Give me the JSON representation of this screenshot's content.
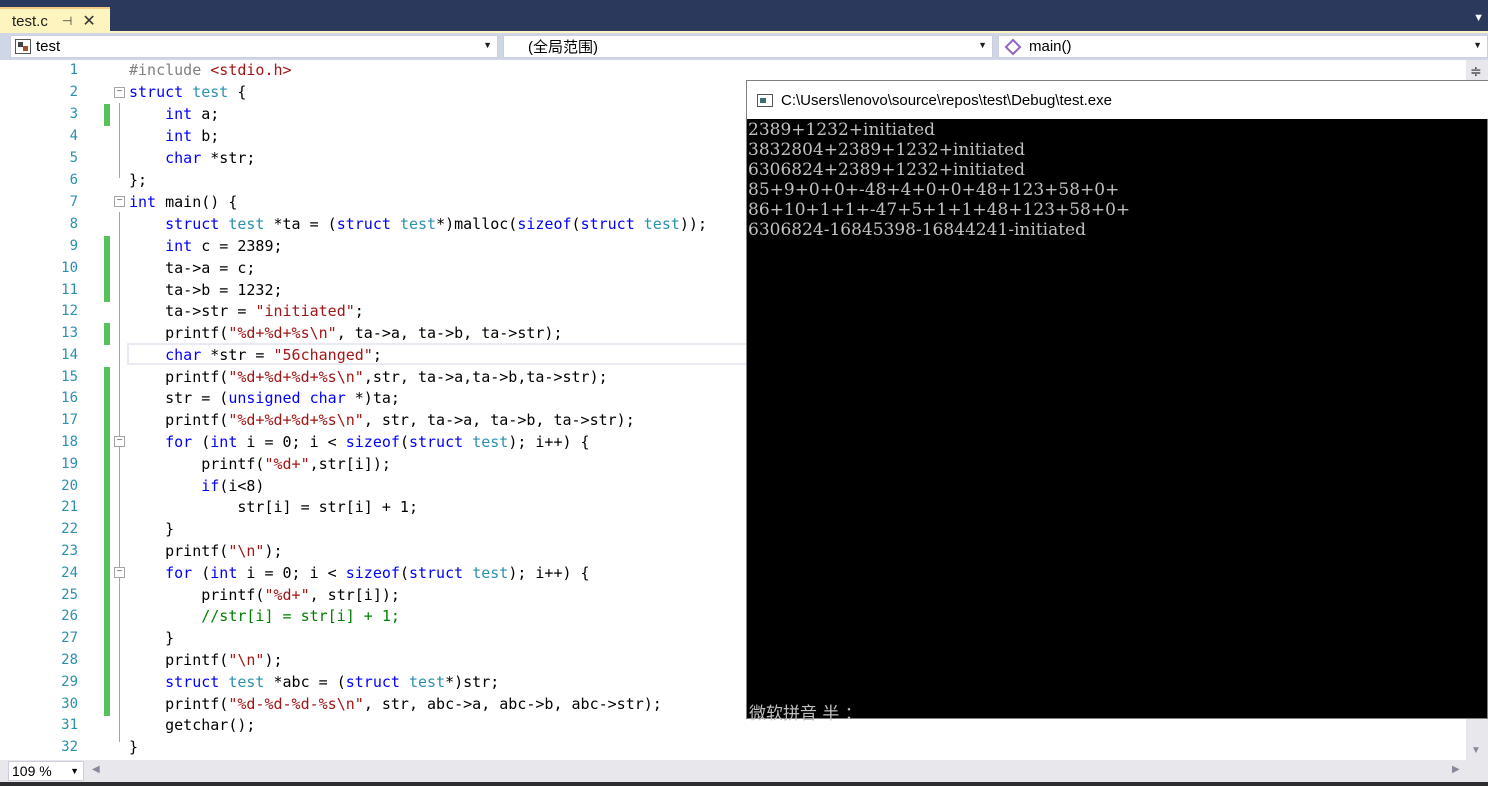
{
  "tab": {
    "title": "test.c",
    "pin": "⊣",
    "close": "✕"
  },
  "navbar": {
    "project": "test",
    "scope": "(全局范围)",
    "member": "main()"
  },
  "editor": {
    "zoom": "109 %",
    "lines": [
      {
        "n": "1",
        "changed": false
      },
      {
        "n": "2",
        "changed": false
      },
      {
        "n": "3",
        "changed": true
      },
      {
        "n": "4",
        "changed": false
      },
      {
        "n": "5",
        "changed": false
      },
      {
        "n": "6",
        "changed": false
      },
      {
        "n": "7",
        "changed": false
      },
      {
        "n": "8",
        "changed": false
      },
      {
        "n": "9",
        "changed": true
      },
      {
        "n": "10",
        "changed": true
      },
      {
        "n": "11",
        "changed": true
      },
      {
        "n": "12",
        "changed": false
      },
      {
        "n": "13",
        "changed": true
      },
      {
        "n": "14",
        "changed": false
      },
      {
        "n": "15",
        "changed": true
      },
      {
        "n": "16",
        "changed": true
      },
      {
        "n": "17",
        "changed": true
      },
      {
        "n": "18",
        "changed": true
      },
      {
        "n": "19",
        "changed": true
      },
      {
        "n": "20",
        "changed": true
      },
      {
        "n": "21",
        "changed": true
      },
      {
        "n": "22",
        "changed": true
      },
      {
        "n": "23",
        "changed": true
      },
      {
        "n": "24",
        "changed": true
      },
      {
        "n": "25",
        "changed": true
      },
      {
        "n": "26",
        "changed": true
      },
      {
        "n": "27",
        "changed": true
      },
      {
        "n": "28",
        "changed": true
      },
      {
        "n": "29",
        "changed": true
      },
      {
        "n": "30",
        "changed": true
      },
      {
        "n": "31",
        "changed": false
      },
      {
        "n": "32",
        "changed": false
      }
    ],
    "code": {
      "l1_pp": "#include ",
      "l1_hdr": "<stdio.h>",
      "l2_kw": "struct",
      "l2_ty": "test",
      "l2_rest": " {",
      "l3_kw": "int",
      "l3_rest": " a;",
      "l4_kw": "int",
      "l4_rest": " b;",
      "l5_kw": "char",
      "l5_rest": " *str;",
      "l6": "};",
      "l7_kw": "int",
      "l7_rest": " main() {",
      "l8_kw1": "struct",
      "l8_ty1": "test",
      "l8_a": " *ta = (",
      "l8_kw2": "struct",
      "l8_ty2": "test",
      "l8_b": "*)malloc(",
      "l8_kw3": "sizeof",
      "l8_c": "(",
      "l8_kw4": "struct",
      "l8_ty3": "test",
      "l8_d": "));",
      "l9_kw": "int",
      "l9_rest": " c = 2389;",
      "l10": "ta->a = c;",
      "l11": "ta->b = 1232;",
      "l12_a": "ta->str = ",
      "l12_s": "\"initiated\"",
      "l12_b": ";",
      "l13_a": "printf(",
      "l13_s": "\"%d+%d+%s\\n\"",
      "l13_b": ", ta->a, ta->b, ta->str);",
      "l14_kw": "char",
      "l14_a": " *str = ",
      "l14_s": "\"56changed\"",
      "l14_b": ";",
      "l15_a": "printf(",
      "l15_s": "\"%d+%d+%d+%s\\n\"",
      "l15_b": ",str, ta->a,ta->b,ta->str);",
      "l16_a": "str = (",
      "l16_kw": "unsigned char",
      "l16_b": " *)ta;",
      "l17_a": "printf(",
      "l17_s": "\"%d+%d+%d+%s\\n\"",
      "l17_b": ", str, ta->a, ta->b, ta->str);",
      "l18_kw1": "for",
      "l18_a": " (",
      "l18_kw2": "int",
      "l18_b": " i = 0; i < ",
      "l18_kw3": "sizeof",
      "l18_c": "(",
      "l18_kw4": "struct",
      "l18_ty": "test",
      "l18_d": "); i++) {",
      "l19_a": "printf(",
      "l19_s": "\"%d+\"",
      "l19_b": ",str[i]);",
      "l20_kw": "if",
      "l20_rest": "(i<8)",
      "l21": "str[i] = str[i] + 1;",
      "l22": "}",
      "l23_a": "printf(",
      "l23_s": "\"\\n\"",
      "l23_b": ");",
      "l24_kw1": "for",
      "l24_a": " (",
      "l24_kw2": "int",
      "l24_b": " i = 0; i < ",
      "l24_kw3": "sizeof",
      "l24_c": "(",
      "l24_kw4": "struct",
      "l24_ty": "test",
      "l24_d": "); i++) {",
      "l25_a": "printf(",
      "l25_s": "\"%d+\"",
      "l25_b": ", str[i]);",
      "l26_cm": "//str[i] = str[i] + 1;",
      "l27": "}",
      "l28_a": "printf(",
      "l28_s": "\"\\n\"",
      "l28_b": ");",
      "l29_kw1": "struct",
      "l29_ty1": "test",
      "l29_a": " *abc = (",
      "l29_kw2": "struct",
      "l29_ty2": "test",
      "l29_b": "*)str;",
      "l30_a": "printf(",
      "l30_s": "\"%d-%d-%d-%s\\n\"",
      "l30_b": ", str, abc->a, abc->b, abc->str);",
      "l31": "getchar();",
      "l32": "}"
    }
  },
  "console": {
    "title": "C:\\Users\\lenovo\\source\\repos\\test\\Debug\\test.exe",
    "lines": [
      "2389+1232+initiated",
      "3832804+2389+1232+initiated",
      "6306824+2389+1232+initiated",
      "85+9+0+0+-48+4+0+0+48+123+58+0+",
      "86+10+1+1+-47+5+1+1+48+123+58+0+",
      "6306824-16845398-16844241-initiated"
    ],
    "ime_status": "微软拼音 半 ："
  },
  "colors": {
    "tab_active": "#fdf4bf",
    "tabstrip": "#2b3a5c",
    "change_bar": "#57c15a",
    "keyword": "#0000ff",
    "type": "#2b91af",
    "string": "#a31515",
    "comment": "#008000"
  }
}
